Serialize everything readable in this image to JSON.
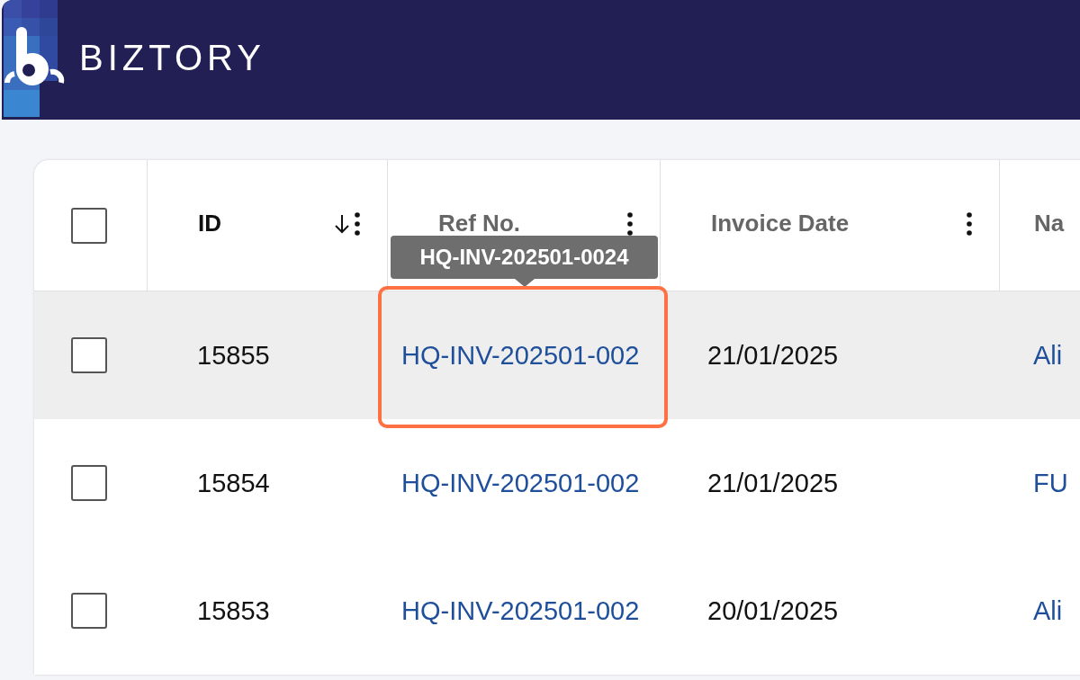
{
  "brand": {
    "name": "BIZTORY"
  },
  "select_all": {
    "checked": false
  },
  "table": {
    "columns": [
      {
        "label": "ID",
        "sorted": true,
        "menu": true
      },
      {
        "label": "Ref No.",
        "sorted": false,
        "menu": true
      },
      {
        "label": "Invoice Date",
        "sorted": false,
        "menu": true
      },
      {
        "label": "Na",
        "sorted": false,
        "menu": false
      }
    ],
    "rows": [
      {
        "checked": false,
        "hovered": true,
        "id": "15855",
        "ref": "HQ-INV-202501-002",
        "date": "21/01/2025",
        "name": "Ali"
      },
      {
        "checked": false,
        "hovered": false,
        "id": "15854",
        "ref": "HQ-INV-202501-002",
        "date": "21/01/2025",
        "name": "FU"
      },
      {
        "checked": false,
        "hovered": false,
        "id": "15853",
        "ref": "HQ-INV-202501-002",
        "date": "20/01/2025",
        "name": "Ali"
      }
    ]
  },
  "tooltip": {
    "text": "HQ-INV-202501-0024"
  }
}
